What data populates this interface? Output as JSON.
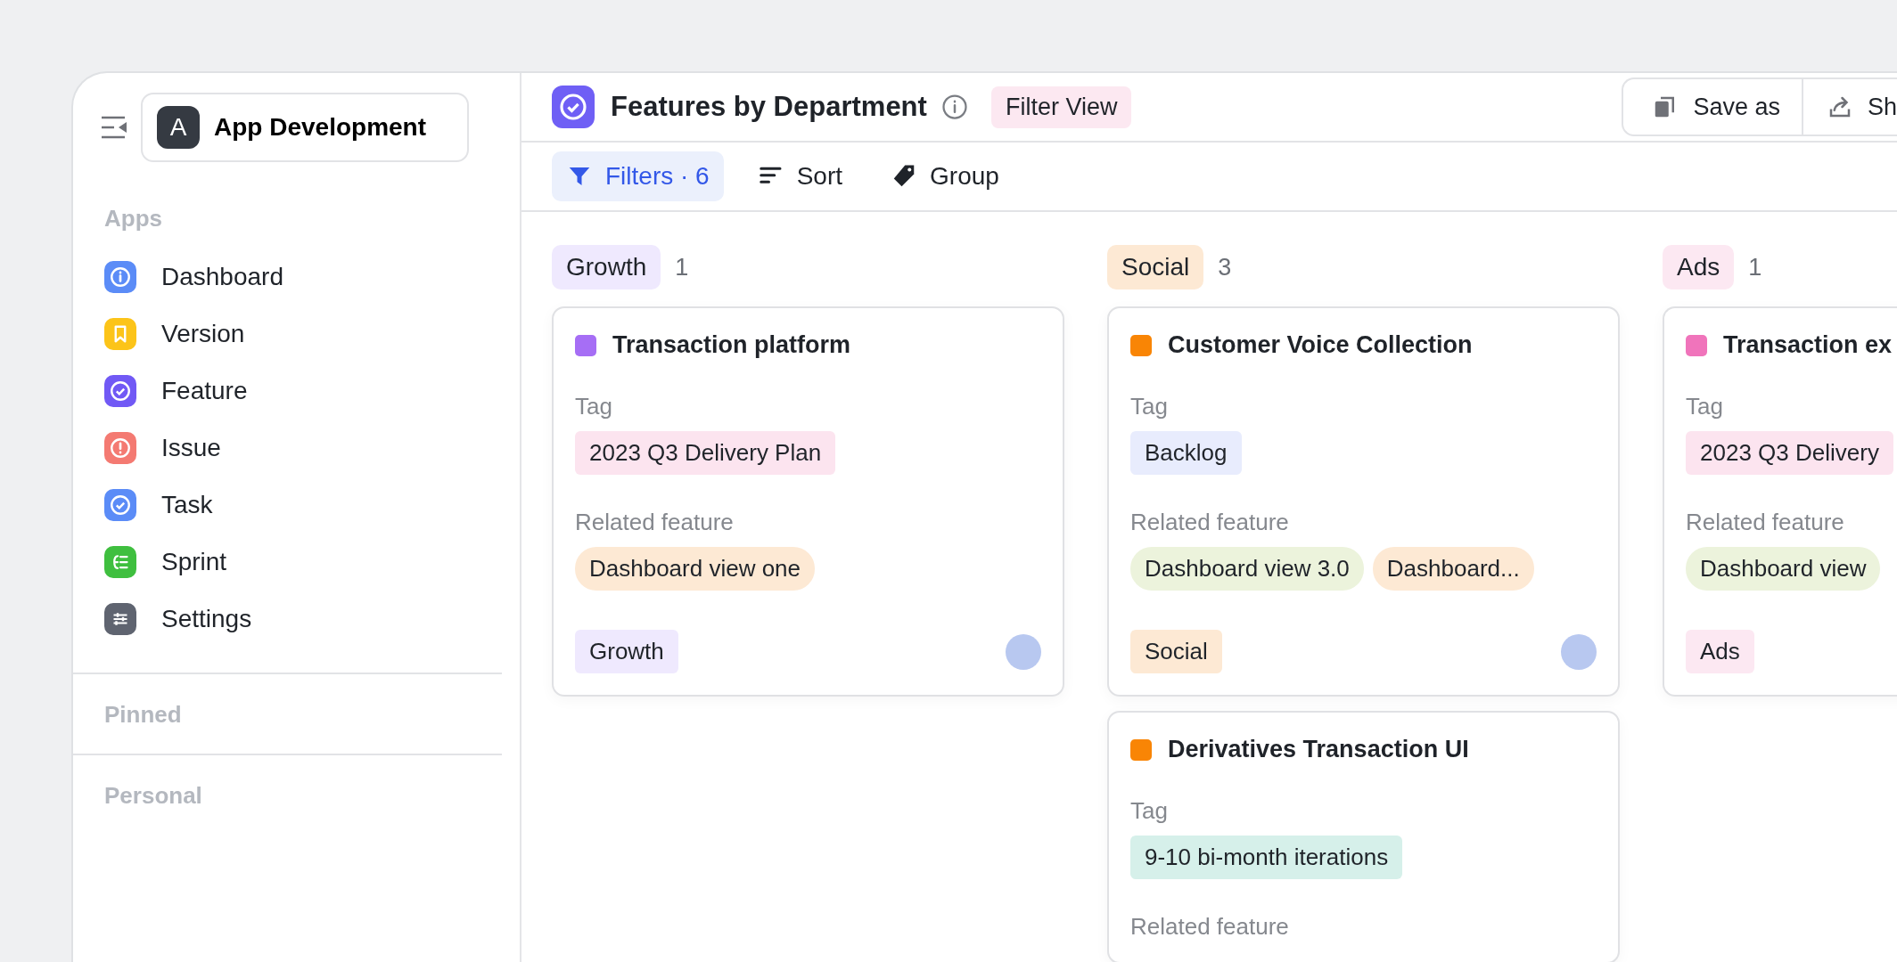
{
  "sidebar": {
    "workspace": {
      "initial": "A",
      "name": "App Development"
    },
    "sections": [
      {
        "title": "Apps",
        "items": [
          {
            "label": "Dashboard",
            "color": "#5b8cf7"
          },
          {
            "label": "Version",
            "color": "#fcc419"
          },
          {
            "label": "Feature",
            "color": "#7159f5"
          },
          {
            "label": "Issue",
            "color": "#f47a72"
          },
          {
            "label": "Task",
            "color": "#5b8cf7"
          },
          {
            "label": "Sprint",
            "color": "#3fbf3f"
          },
          {
            "label": "Settings",
            "color": "#5f6470"
          }
        ]
      },
      {
        "title": "Pinned"
      },
      {
        "title": "Personal"
      }
    ]
  },
  "header": {
    "title": "Features by Department",
    "badge": "Filter View",
    "actions": [
      {
        "label": "Save as"
      },
      {
        "label": "Sh"
      }
    ]
  },
  "toolbar": [
    {
      "label": "Filters · 6",
      "selected": true
    },
    {
      "label": "Sort",
      "selected": false
    },
    {
      "label": "Group",
      "selected": false
    }
  ],
  "columns": [
    {
      "label": "Growth",
      "color": "#efe9fe",
      "count": "1",
      "cards": [
        {
          "title": "Transaction platform",
          "color": "#a66ef5",
          "tag_label": "Tag",
          "tags": [
            {
              "label": "2023 Q3 Delivery Plan",
              "color": "#fce4ef"
            }
          ],
          "related_label": "Related feature",
          "related": [
            {
              "label": "Dashboard view one",
              "color": "#fde9d4"
            }
          ],
          "department": {
            "label": "Growth",
            "color": "#efe9fe"
          },
          "avatar": true
        }
      ]
    },
    {
      "label": "Social",
      "color": "#fde9d4",
      "count": "3",
      "cards": [
        {
          "title": "Customer Voice Collection",
          "color": "#f98505",
          "tag_label": "Tag",
          "tags": [
            {
              "label": "Backlog",
              "color": "#e8ecfd"
            }
          ],
          "related_label": "Related feature",
          "related": [
            {
              "label": "Dashboard view 3.0",
              "color": "#ecf3dc"
            },
            {
              "label": "Dashboard...",
              "color": "#fde9d4"
            }
          ],
          "department": {
            "label": "Social",
            "color": "#fde9d4"
          },
          "avatar": true
        },
        {
          "title": "Derivatives Transaction UI",
          "color": "#f98505",
          "tag_label": "Tag",
          "tags": [
            {
              "label": "9-10 bi-month iterations",
              "color": "#d6f0ea"
            }
          ],
          "related_label": "Related feature"
        }
      ]
    },
    {
      "label": "Ads",
      "color": "#fce8f2",
      "count": "1",
      "cards": [
        {
          "title": "Transaction ex",
          "color": "#f074bb",
          "tag_label": "Tag",
          "tags": [
            {
              "label": "2023 Q3 Delivery",
              "color": "#fce4ef"
            }
          ],
          "related_label": "Related feature",
          "related": [
            {
              "label": "Dashboard view",
              "color": "#ecf3dc"
            }
          ],
          "department": {
            "label": "Ads",
            "color": "#fce8f2"
          }
        }
      ]
    }
  ]
}
